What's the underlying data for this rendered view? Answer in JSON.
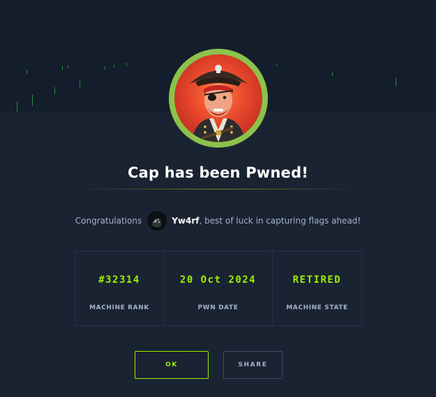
{
  "dialog": {
    "title": "Cap has been Pwned!",
    "machine_avatar_icon": "pirate-machine-avatar",
    "accent_color": "#9fef00"
  },
  "congrats": {
    "prefix": "Congratulations",
    "username": "Yw4rf",
    "suffix": ", best of luck in capturing flags ahead!"
  },
  "stats": [
    {
      "value": "#32314",
      "label": "MACHINE RANK"
    },
    {
      "value": "20 Oct 2024",
      "label": "PWN DATE"
    },
    {
      "value": "RETIRED",
      "label": "MACHINE STATE"
    }
  ],
  "buttons": {
    "ok": "OK",
    "share": "SHARE"
  }
}
